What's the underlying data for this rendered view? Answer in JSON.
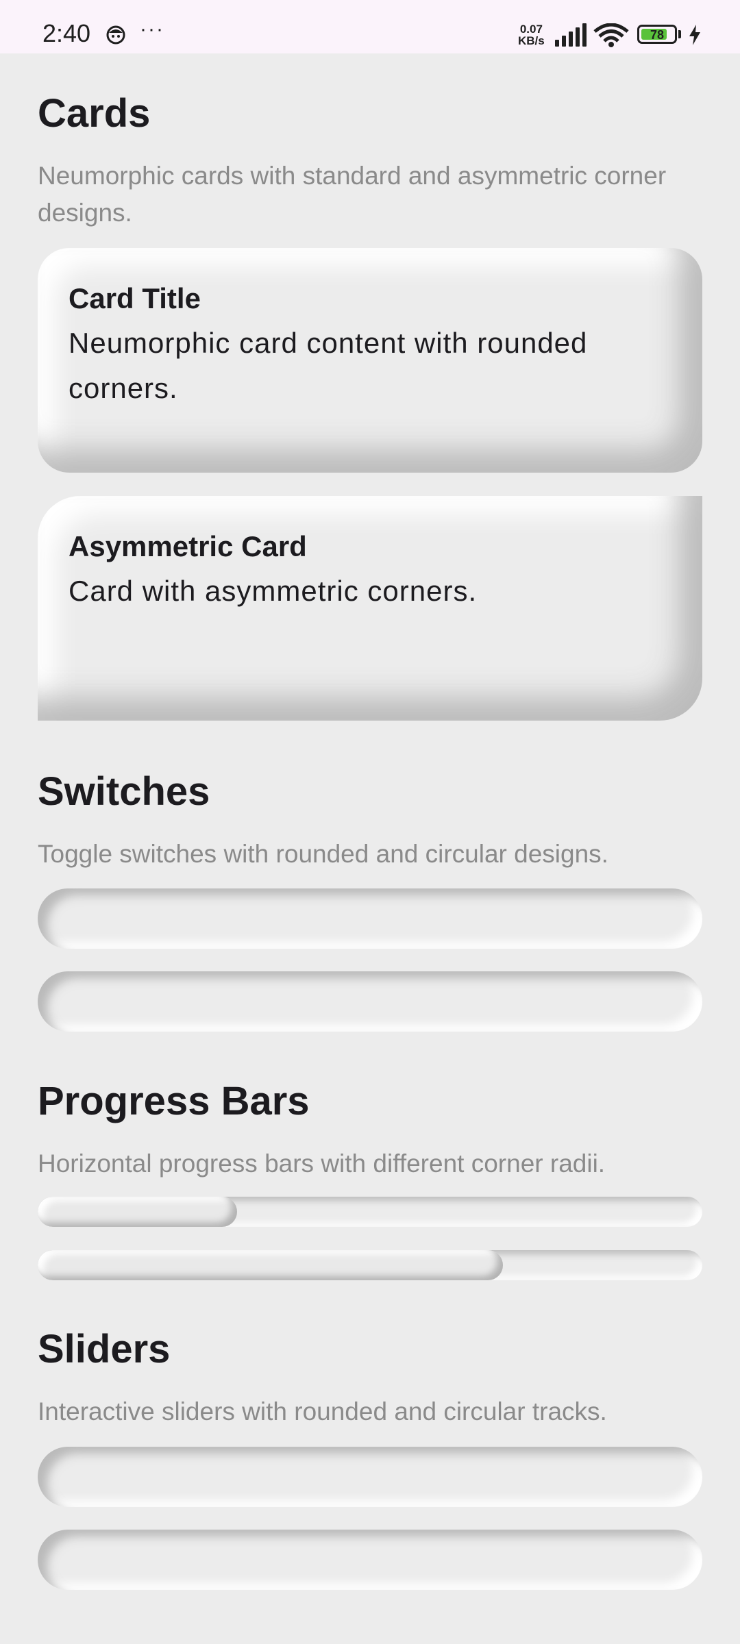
{
  "status_bar": {
    "time": "2:40",
    "more_indicator": "···",
    "net_speed_value": "0.07",
    "net_speed_unit": "KB/s",
    "battery_level": "78",
    "icons": [
      "face-icon",
      "signal-icon",
      "wifi-icon",
      "battery-icon",
      "charging-bolt-icon"
    ]
  },
  "sections": {
    "cards": {
      "title": "Cards",
      "description": "Neumorphic cards with standard and asymmetric corner designs.",
      "card1": {
        "title": "Card Title",
        "body": "Neumorphic card content with rounded corners."
      },
      "card2": {
        "title": "Asymmetric Card",
        "body": "Card with asymmetric corners."
      }
    },
    "switches": {
      "title": "Switches",
      "description": "Toggle switches with rounded and circular designs."
    },
    "progress": {
      "title": "Progress Bars",
      "description": "Horizontal progress bars with different corner radii.",
      "bars": [
        {
          "value": 0.3
        },
        {
          "value": 0.7
        }
      ]
    },
    "sliders": {
      "title": "Sliders",
      "description": "Interactive sliders with rounded and circular tracks."
    }
  },
  "colors": {
    "background": "#ececec",
    "status_bar": "#fbf3fb",
    "text_primary": "#1c1b1f",
    "text_secondary": "#8a8a8a",
    "battery_fill": "#59c23a"
  }
}
